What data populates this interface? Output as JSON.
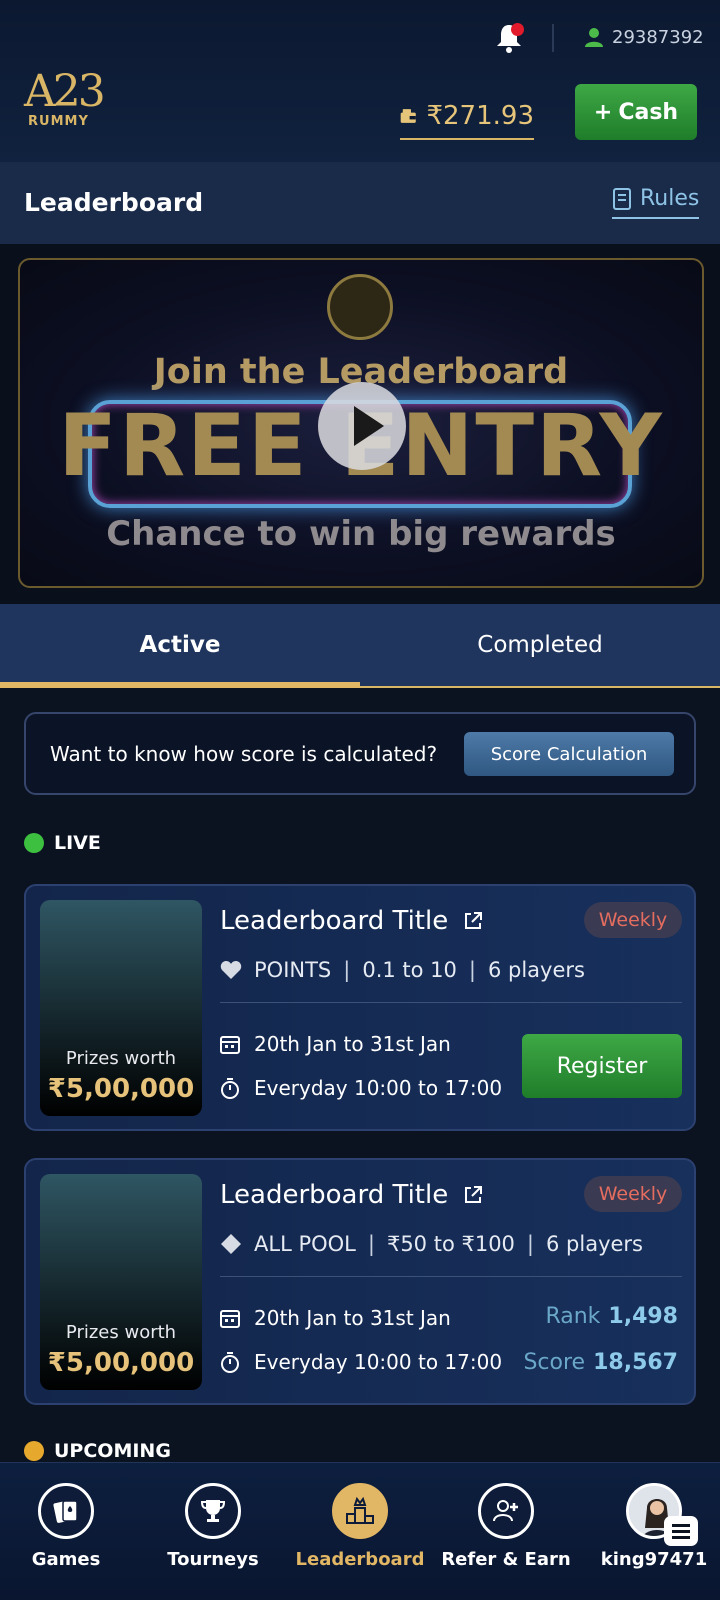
{
  "header": {
    "user_id": "29387392",
    "logo_text": "A23",
    "logo_sub": "RUMMY",
    "wallet_amount": "₹271.93",
    "cash_button": "Cash"
  },
  "page": {
    "title": "Leaderboard",
    "rules": "Rules"
  },
  "banner": {
    "join": "Join the Leaderboard",
    "free": "FREE ENTRY",
    "chance": "Chance to win big rewards"
  },
  "tabs": [
    "Active",
    "Completed"
  ],
  "score_box": {
    "question": "Want to know how score is calculated?",
    "button": "Score Calculation"
  },
  "sections": {
    "live": "LIVE",
    "upcoming": "UPCOMING"
  },
  "cards": [
    {
      "prizes_label": "Prizes worth",
      "prizes_amount": "₹5,00,000",
      "title": "Leaderboard Title",
      "badge": "Weekly",
      "game": "POINTS",
      "stakes": "0.1 to 10",
      "players": "6 players",
      "dates": "20th Jan to 31st Jan",
      "time": "Everyday 10:00 to 17:00",
      "action": "Register"
    },
    {
      "prizes_label": "Prizes worth",
      "prizes_amount": "₹5,00,000",
      "title": "Leaderboard Title",
      "badge": "Weekly",
      "game": "ALL POOL",
      "stakes": "₹50 to ₹100",
      "players": "6 players",
      "dates": "20th Jan to 31st Jan",
      "time": "Everyday 10:00 to 17:00",
      "rank_label": "Rank",
      "rank": "1,498",
      "score_label": "Score",
      "score": "18,567"
    }
  ],
  "bottom_nav": [
    {
      "label": "Games",
      "icon": "cards-icon"
    },
    {
      "label": "Tourneys",
      "icon": "trophy-icon"
    },
    {
      "label": "Leaderboard",
      "icon": "podium-icon"
    },
    {
      "label": "Refer & Earn",
      "icon": "refer-user-icon"
    },
    {
      "label": "king97471",
      "icon": "avatar"
    }
  ],
  "colors": {
    "accent_gold": "#e1b664",
    "green": "#2f9a3a",
    "live_dot": "#3dbf3f",
    "upcoming_dot": "#e7a92d",
    "badge_text": "#e46d5f"
  }
}
